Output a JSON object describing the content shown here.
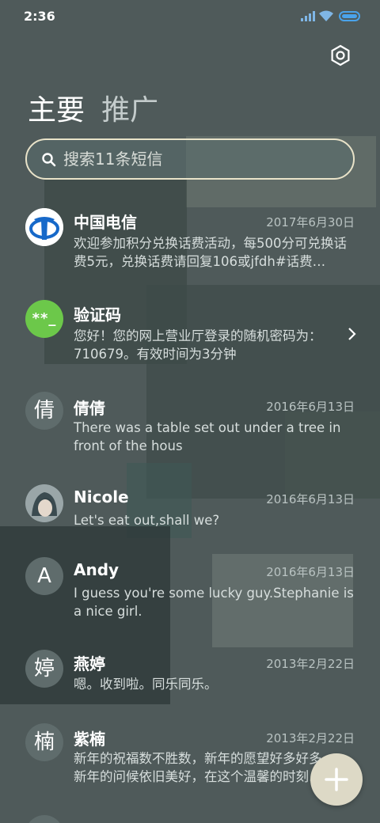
{
  "status_bar": {
    "time": "2:36"
  },
  "tabs": [
    {
      "label": "主要",
      "active": true
    },
    {
      "label": "推广",
      "active": false
    }
  ],
  "search": {
    "placeholder": "搜索11条短信"
  },
  "conversations": [
    {
      "name": "中国电信",
      "date": "2017年6月30日",
      "preview": "欢迎参加积分兑换话费活动，每500分可兑换话费5元，兑换话费请回复106或jfdh#话费…",
      "avatar": "china-telecom-logo"
    },
    {
      "name": "验证码",
      "date": "",
      "preview": "您好！您的网上营业厅登录的随机密码为：710679。有效时间为3分钟",
      "avatar_text": "**_"
    },
    {
      "name": "倩倩",
      "date": "2016年6月13日",
      "preview": "There was a table set out under a tree in front of the hous",
      "avatar_text": "倩"
    },
    {
      "name": "Nicole",
      "date": "2016年6月13日",
      "preview": "Let's eat out,shall we?",
      "avatar": "photo"
    },
    {
      "name": "Andy",
      "date": "2016年6月13日",
      "preview": "I guess you're some lucky guy.Stephanie is a nice girl.",
      "avatar_text": "A"
    },
    {
      "name": "燕婷",
      "date": "2013年2月22日",
      "preview": "嗯。收到啦。同乐同乐。",
      "avatar_text": "婷"
    },
    {
      "name": "紫楠",
      "date": "2013年2月22日",
      "preview": "新年的祝福数不胜数，新年的愿望好多好多，新年的问候依旧美好，在这个温馨的时刻…",
      "avatar_text": "楠"
    }
  ],
  "colors": {
    "background": "#4f5a5a",
    "accent_green": "#6cc84a",
    "telecom_blue": "#1769c9",
    "fab": "#ddd9c6"
  },
  "icons": [
    "settings-gear-icon",
    "search-icon",
    "chevron-right-icon",
    "add-icon"
  ]
}
